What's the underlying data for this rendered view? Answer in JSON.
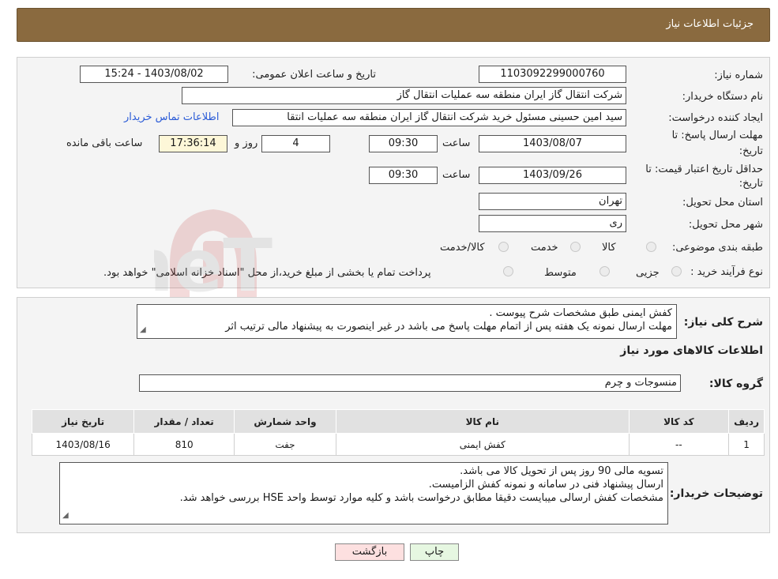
{
  "header": {
    "title": "جزئیات اطلاعات نیاز"
  },
  "form": {
    "need_number_label": "شماره نیاز:",
    "need_number": "1103092299000760",
    "announce_label": "تاریخ و ساعت اعلان عمومی:",
    "announce_value": "1403/08/02 - 15:24",
    "buyer_org_label": "نام دستگاه خریدار:",
    "buyer_org": "شرکت انتقال گاز ایران منطقه سه عملیات انتقال گاز",
    "creator_label": "ایجاد کننده درخواست:",
    "creator": "سید امین حسینی مسئول خرید شرکت انتقال گاز ایران منطقه سه عملیات انتقا",
    "contact_link": "اطلاعات تماس خریدار",
    "deadline_label_1": "مهلت ارسال پاسخ: تا",
    "deadline_label_2": "تاریخ:",
    "deadline_date": "1403/08/07",
    "time_label": "ساعت",
    "deadline_time": "09:30",
    "days_value": "4",
    "days_label": "روز و",
    "remaining_time": "17:36:14",
    "remaining_label": "ساعت باقی مانده",
    "validity_label_1": "حداقل تاریخ اعتبار قیمت: تا",
    "validity_label_2": "تاریخ:",
    "validity_date": "1403/09/26",
    "validity_time": "09:30",
    "province_label": "استان محل تحویل:",
    "province": "تهران",
    "city_label": "شهر محل تحویل:",
    "city": "ری",
    "category_label": "طبقه بندی موضوعی:",
    "category_options": [
      "کالا",
      "خدمت",
      "کالا/خدمت"
    ],
    "process_label": "نوع فرآیند خرید :",
    "process_options": [
      "جزیی",
      "متوسط"
    ],
    "process_note": "پرداخت تمام یا بخشی از مبلغ خرید،از محل \"اسناد خزانه اسلامی\" خواهد بود."
  },
  "details": {
    "summary_label": "شرح کلی نیاز:",
    "summary_line1": "کفش ایمنی طبق مشخصات شرح پیوست .",
    "summary_line2": "مهلت ارسال نمونه یک هفته پس از اتمام مهلت پاسخ می باشد در غیر اینصورت به پیشنهاد مالی ترتیب اثر",
    "goods_info_title": "اطلاعات کالاهای مورد نیاز",
    "group_label": "گروه کالا:",
    "group_value": "منسوجات و چرم",
    "table": {
      "headers": [
        "ردیف",
        "کد کالا",
        "نام کالا",
        "واحد شمارش",
        "تعداد / مقدار",
        "تاریخ نیاز"
      ],
      "rows": [
        [
          "1",
          "--",
          "کفش ایمنی",
          "جفت",
          "810",
          "1403/08/16"
        ]
      ]
    },
    "buyer_notes_label": "توضیحات خریدار:",
    "buyer_notes": [
      "تسویه مالی 90 روز پس از تحویل کالا می باشد.",
      "ارسال پیشنهاد فنی در سامانه  و نمونه کفش الزامیست.",
      "مشخصات کفش ارسالی میبایست دقیقا مطابق درخواست باشد و کلیه موارد توسط واحد HSE بررسی خواهد شد."
    ]
  },
  "buttons": {
    "print": "چاپ",
    "back": "بازگشت"
  },
  "watermark": {
    "text": "AriaTender.neT"
  },
  "colors": {
    "header_bg": "#8a6a3f",
    "link": "#2a5bd7",
    "back_btn": "#fde0e0",
    "print_btn": "#e6f7e1"
  }
}
